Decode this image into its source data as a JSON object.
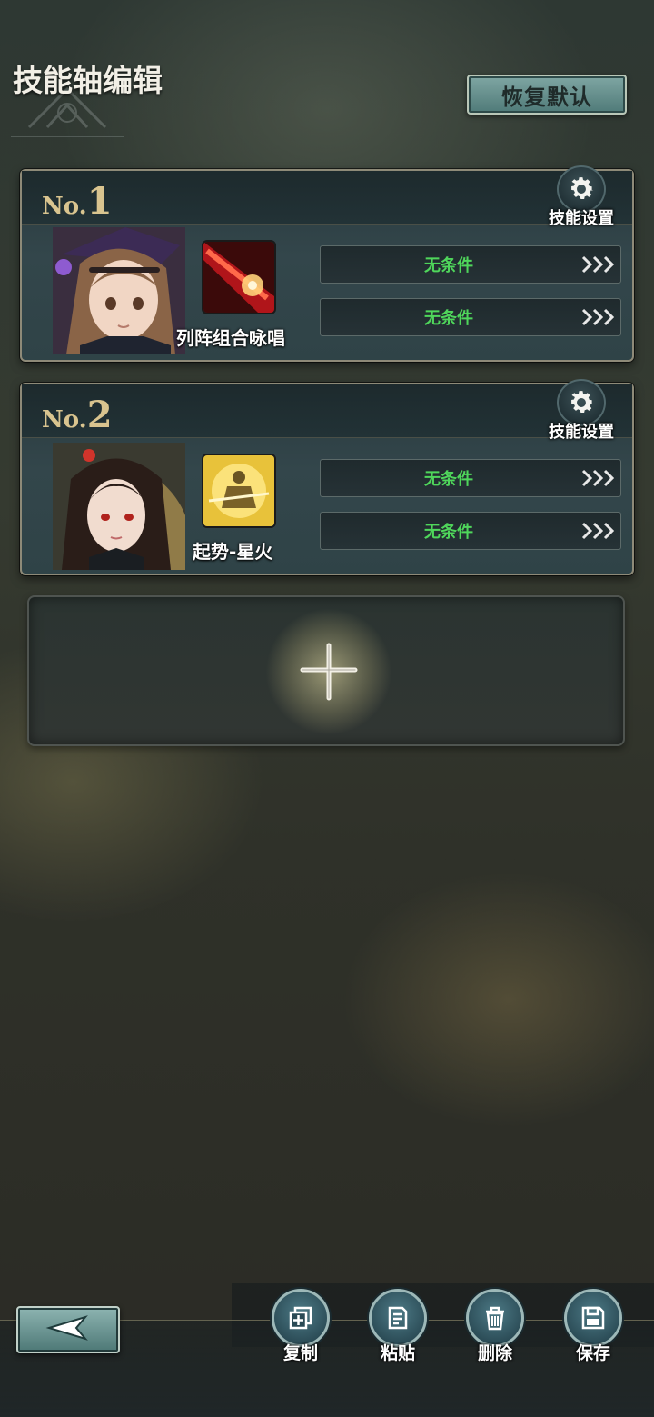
{
  "header": {
    "title": "技能轴编辑",
    "reset_label": "恢复默认"
  },
  "cards": [
    {
      "no_prefix": "No.",
      "number": "1",
      "settings_label": "技能设置",
      "skill_name": "列阵组合咏唱",
      "conditions": [
        "无条件",
        "无条件"
      ]
    },
    {
      "no_prefix": "No.",
      "number": "2",
      "settings_label": "技能设置",
      "skill_name": "起势-星火",
      "conditions": [
        "无条件",
        "无条件"
      ]
    }
  ],
  "toolbar": {
    "copy_label": "复制",
    "paste_label": "粘贴",
    "delete_label": "删除",
    "save_label": "保存"
  },
  "icons": {
    "settings": "gear-icon",
    "condition_arrow": "triple-chevron-right-icon",
    "add": "plus-icon",
    "back": "back-arrow-icon",
    "copy": "copy-icon",
    "paste": "paste-icon",
    "delete": "trash-icon",
    "save": "floppy-disk-icon"
  },
  "colors": {
    "condition_text": "#4fd65b",
    "number_gold": "#d9c48f",
    "accent_teal": "#5f8d8b"
  }
}
